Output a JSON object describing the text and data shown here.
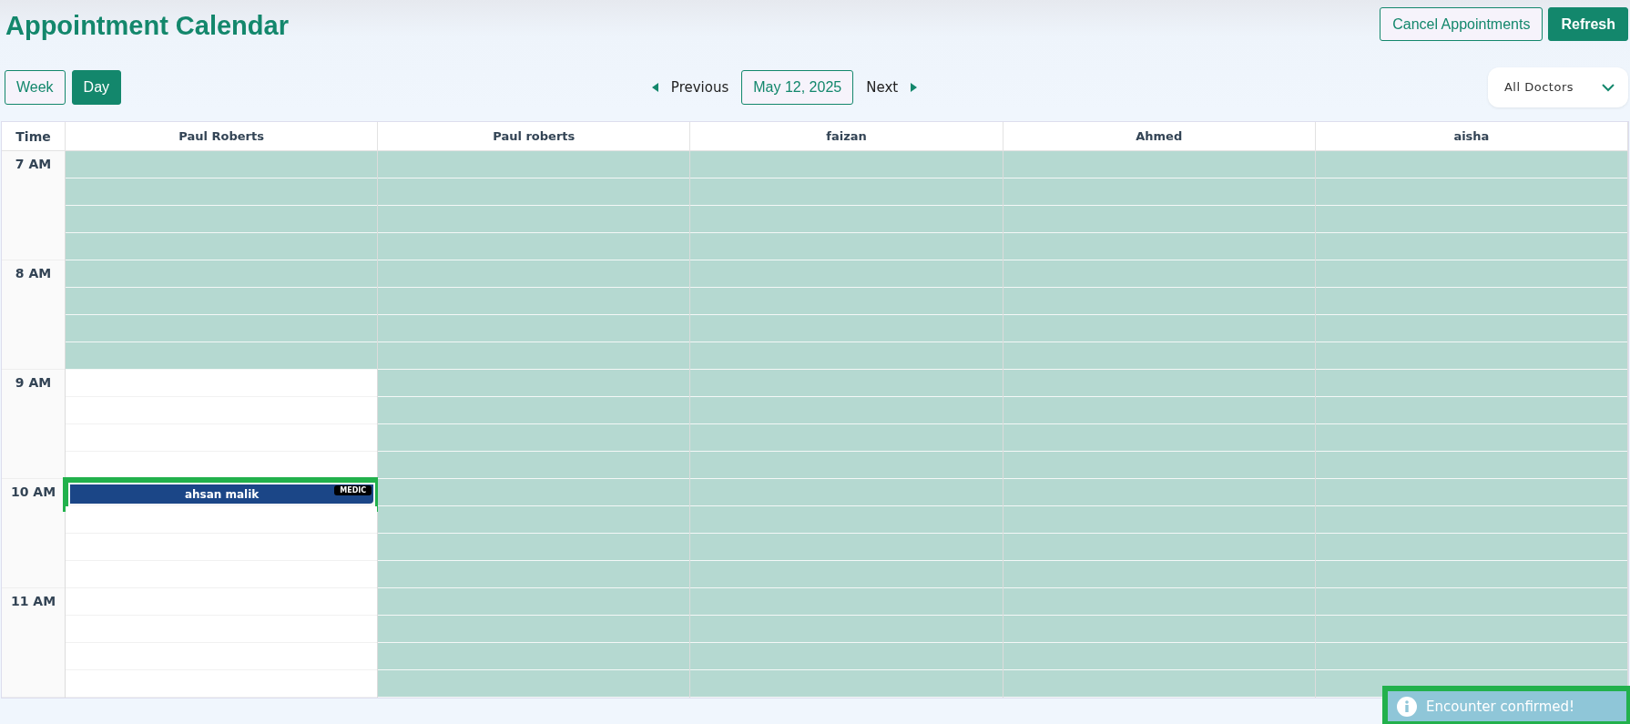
{
  "title": "Appointment Calendar",
  "header_buttons": [
    {
      "label": "Cancel Appointments",
      "kind": "outline"
    },
    {
      "label": "Refresh",
      "kind": "solid"
    }
  ],
  "view_tabs": [
    {
      "label": "Week",
      "selected": false
    },
    {
      "label": "Day",
      "selected": true
    }
  ],
  "nav": {
    "previous": "Previous",
    "date": "May 12, 2025",
    "next": "Next"
  },
  "doctor_filter": {
    "value": "All Doctors"
  },
  "grid": {
    "time_heading": "Time",
    "hours": [
      "7 AM",
      "8 AM",
      "9 AM",
      "10 AM",
      "11 AM"
    ],
    "doctors": [
      {
        "name": "Paul Roberts",
        "slots": [
          {
            "available": false
          },
          {
            "available": false
          },
          {
            "available": false
          },
          {
            "available": false
          },
          {
            "available": false
          },
          {
            "available": false
          },
          {
            "available": false
          },
          {
            "available": false
          },
          {
            "available": true
          },
          {
            "available": true
          },
          {
            "available": true
          },
          {
            "available": true
          },
          {
            "appointment": {
              "patient": "ahsan malik",
              "badge": "MEDIC"
            }
          },
          {
            "available": true
          },
          {
            "available": true
          },
          {
            "available": true
          },
          {
            "available": true
          },
          {
            "available": true
          },
          {
            "available": true
          },
          {
            "available": true
          }
        ]
      },
      {
        "name": "Paul roberts",
        "slots": [
          {
            "available": false
          },
          {
            "available": false
          },
          {
            "available": false
          },
          {
            "available": false
          },
          {
            "available": false
          },
          {
            "available": false
          },
          {
            "available": false
          },
          {
            "available": false
          },
          {
            "available": false
          },
          {
            "available": false
          },
          {
            "available": false
          },
          {
            "available": false
          },
          {
            "available": false
          },
          {
            "available": false
          },
          {
            "available": false
          },
          {
            "available": false
          },
          {
            "available": false
          },
          {
            "available": false
          },
          {
            "available": false
          },
          {
            "available": false
          }
        ]
      },
      {
        "name": "faizan",
        "slots": [
          {
            "available": false
          },
          {
            "available": false
          },
          {
            "available": false
          },
          {
            "available": false
          },
          {
            "available": false
          },
          {
            "available": false
          },
          {
            "available": false
          },
          {
            "available": false
          },
          {
            "available": false
          },
          {
            "available": false
          },
          {
            "available": false
          },
          {
            "available": false
          },
          {
            "available": false
          },
          {
            "available": false
          },
          {
            "available": false
          },
          {
            "available": false
          },
          {
            "available": false
          },
          {
            "available": false
          },
          {
            "available": false
          },
          {
            "available": false
          }
        ]
      },
      {
        "name": "Ahmed",
        "slots": [
          {
            "available": false
          },
          {
            "available": false
          },
          {
            "available": false
          },
          {
            "available": false
          },
          {
            "available": false
          },
          {
            "available": false
          },
          {
            "available": false
          },
          {
            "available": false
          },
          {
            "available": false
          },
          {
            "available": false
          },
          {
            "available": false
          },
          {
            "available": false
          },
          {
            "available": false
          },
          {
            "available": false
          },
          {
            "available": false
          },
          {
            "available": false
          },
          {
            "available": false
          },
          {
            "available": false
          },
          {
            "available": false
          },
          {
            "available": false
          }
        ]
      },
      {
        "name": "aisha",
        "slots": [
          {
            "available": false
          },
          {
            "available": false
          },
          {
            "available": false
          },
          {
            "available": false
          },
          {
            "available": false
          },
          {
            "available": false
          },
          {
            "available": false
          },
          {
            "available": false
          },
          {
            "available": false
          },
          {
            "available": false
          },
          {
            "available": false
          },
          {
            "available": false
          },
          {
            "available": false
          },
          {
            "available": false
          },
          {
            "available": false
          },
          {
            "available": false
          },
          {
            "available": false
          },
          {
            "available": false
          },
          {
            "available": false
          },
          {
            "available": false
          }
        ]
      }
    ]
  },
  "toast": {
    "message": "Encounter confirmed!"
  }
}
